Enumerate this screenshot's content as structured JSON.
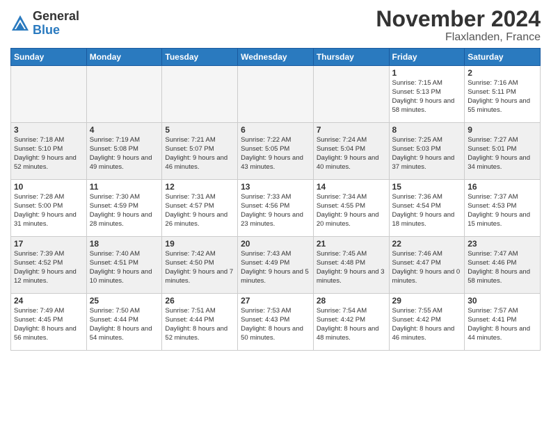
{
  "logo": {
    "general": "General",
    "blue": "Blue"
  },
  "header": {
    "month": "November 2024",
    "location": "Flaxlanden, France"
  },
  "weekdays": [
    "Sunday",
    "Monday",
    "Tuesday",
    "Wednesday",
    "Thursday",
    "Friday",
    "Saturday"
  ],
  "weeks": [
    [
      {
        "day": "",
        "info": ""
      },
      {
        "day": "",
        "info": ""
      },
      {
        "day": "",
        "info": ""
      },
      {
        "day": "",
        "info": ""
      },
      {
        "day": "",
        "info": ""
      },
      {
        "day": "1",
        "info": "Sunrise: 7:15 AM\nSunset: 5:13 PM\nDaylight: 9 hours and 58 minutes."
      },
      {
        "day": "2",
        "info": "Sunrise: 7:16 AM\nSunset: 5:11 PM\nDaylight: 9 hours and 55 minutes."
      }
    ],
    [
      {
        "day": "3",
        "info": "Sunrise: 7:18 AM\nSunset: 5:10 PM\nDaylight: 9 hours and 52 minutes."
      },
      {
        "day": "4",
        "info": "Sunrise: 7:19 AM\nSunset: 5:08 PM\nDaylight: 9 hours and 49 minutes."
      },
      {
        "day": "5",
        "info": "Sunrise: 7:21 AM\nSunset: 5:07 PM\nDaylight: 9 hours and 46 minutes."
      },
      {
        "day": "6",
        "info": "Sunrise: 7:22 AM\nSunset: 5:05 PM\nDaylight: 9 hours and 43 minutes."
      },
      {
        "day": "7",
        "info": "Sunrise: 7:24 AM\nSunset: 5:04 PM\nDaylight: 9 hours and 40 minutes."
      },
      {
        "day": "8",
        "info": "Sunrise: 7:25 AM\nSunset: 5:03 PM\nDaylight: 9 hours and 37 minutes."
      },
      {
        "day": "9",
        "info": "Sunrise: 7:27 AM\nSunset: 5:01 PM\nDaylight: 9 hours and 34 minutes."
      }
    ],
    [
      {
        "day": "10",
        "info": "Sunrise: 7:28 AM\nSunset: 5:00 PM\nDaylight: 9 hours and 31 minutes."
      },
      {
        "day": "11",
        "info": "Sunrise: 7:30 AM\nSunset: 4:59 PM\nDaylight: 9 hours and 28 minutes."
      },
      {
        "day": "12",
        "info": "Sunrise: 7:31 AM\nSunset: 4:57 PM\nDaylight: 9 hours and 26 minutes."
      },
      {
        "day": "13",
        "info": "Sunrise: 7:33 AM\nSunset: 4:56 PM\nDaylight: 9 hours and 23 minutes."
      },
      {
        "day": "14",
        "info": "Sunrise: 7:34 AM\nSunset: 4:55 PM\nDaylight: 9 hours and 20 minutes."
      },
      {
        "day": "15",
        "info": "Sunrise: 7:36 AM\nSunset: 4:54 PM\nDaylight: 9 hours and 18 minutes."
      },
      {
        "day": "16",
        "info": "Sunrise: 7:37 AM\nSunset: 4:53 PM\nDaylight: 9 hours and 15 minutes."
      }
    ],
    [
      {
        "day": "17",
        "info": "Sunrise: 7:39 AM\nSunset: 4:52 PM\nDaylight: 9 hours and 12 minutes."
      },
      {
        "day": "18",
        "info": "Sunrise: 7:40 AM\nSunset: 4:51 PM\nDaylight: 9 hours and 10 minutes."
      },
      {
        "day": "19",
        "info": "Sunrise: 7:42 AM\nSunset: 4:50 PM\nDaylight: 9 hours and 7 minutes."
      },
      {
        "day": "20",
        "info": "Sunrise: 7:43 AM\nSunset: 4:49 PM\nDaylight: 9 hours and 5 minutes."
      },
      {
        "day": "21",
        "info": "Sunrise: 7:45 AM\nSunset: 4:48 PM\nDaylight: 9 hours and 3 minutes."
      },
      {
        "day": "22",
        "info": "Sunrise: 7:46 AM\nSunset: 4:47 PM\nDaylight: 9 hours and 0 minutes."
      },
      {
        "day": "23",
        "info": "Sunrise: 7:47 AM\nSunset: 4:46 PM\nDaylight: 8 hours and 58 minutes."
      }
    ],
    [
      {
        "day": "24",
        "info": "Sunrise: 7:49 AM\nSunset: 4:45 PM\nDaylight: 8 hours and 56 minutes."
      },
      {
        "day": "25",
        "info": "Sunrise: 7:50 AM\nSunset: 4:44 PM\nDaylight: 8 hours and 54 minutes."
      },
      {
        "day": "26",
        "info": "Sunrise: 7:51 AM\nSunset: 4:44 PM\nDaylight: 8 hours and 52 minutes."
      },
      {
        "day": "27",
        "info": "Sunrise: 7:53 AM\nSunset: 4:43 PM\nDaylight: 8 hours and 50 minutes."
      },
      {
        "day": "28",
        "info": "Sunrise: 7:54 AM\nSunset: 4:42 PM\nDaylight: 8 hours and 48 minutes."
      },
      {
        "day": "29",
        "info": "Sunrise: 7:55 AM\nSunset: 4:42 PM\nDaylight: 8 hours and 46 minutes."
      },
      {
        "day": "30",
        "info": "Sunrise: 7:57 AM\nSunset: 4:41 PM\nDaylight: 8 hours and 44 minutes."
      }
    ]
  ]
}
